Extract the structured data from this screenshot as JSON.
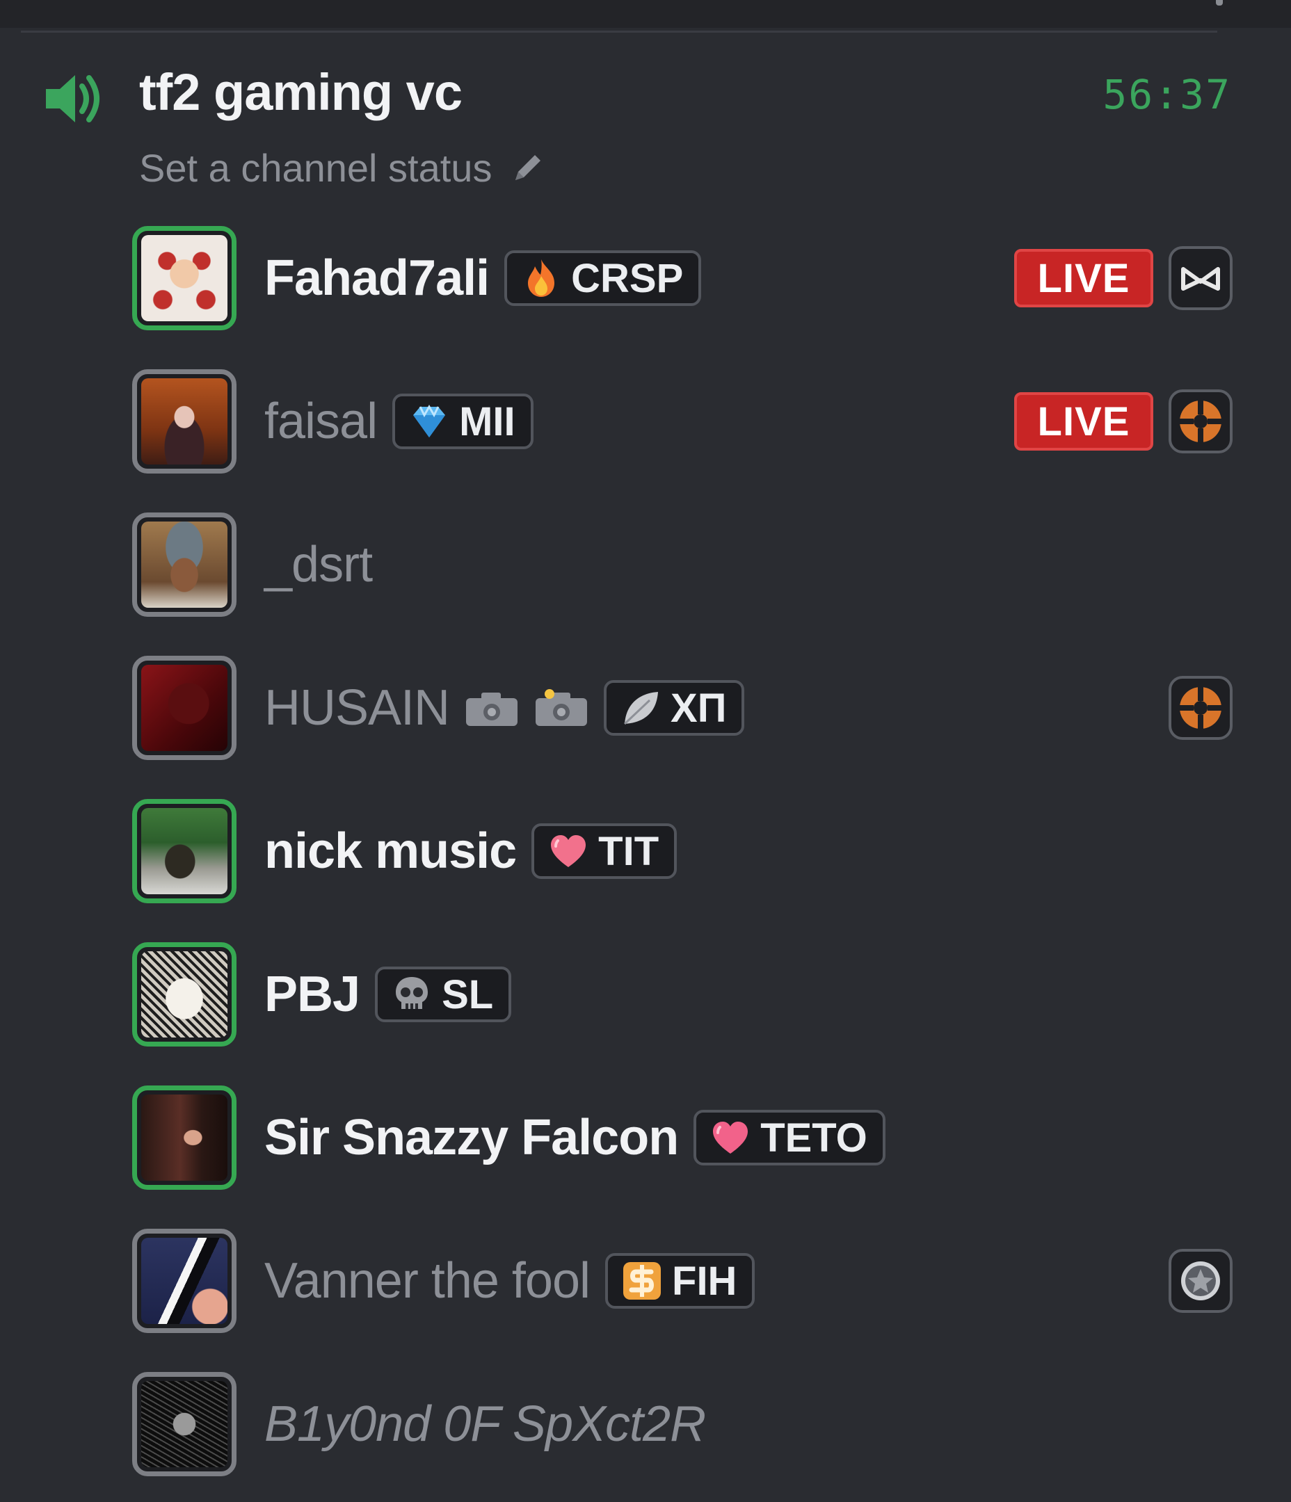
{
  "channel": {
    "name": "tf2 gaming vc",
    "timer": "56:37",
    "status_placeholder": "Set a channel status",
    "speaker_icon": "speaker-active-icon",
    "accent_color": "#3ba55d"
  },
  "members": [
    {
      "name": "Fahad7ali",
      "speaking": true,
      "tag": {
        "icon": "fire-icon",
        "label": "CRSP"
      },
      "live_label": "LIVE",
      "activity_icon": "mask-activity-icon"
    },
    {
      "name": "faisal",
      "speaking": false,
      "tag": {
        "icon": "diamond-icon",
        "label": "MII"
      },
      "live_label": "LIVE",
      "activity_icon": "tf2-logo-icon"
    },
    {
      "name": "_dsrt",
      "speaking": false
    },
    {
      "name": "HUSAIN",
      "speaking": false,
      "extra_icons": [
        "camera-icon",
        "camera-icon"
      ],
      "tag": {
        "icon": "leaf-icon",
        "label": "XП"
      },
      "activity_icon": "tf2-logo-icon"
    },
    {
      "name": "nick music",
      "speaking": true,
      "tag": {
        "icon": "heart-icon",
        "label": "TIT"
      }
    },
    {
      "name": "PBJ",
      "speaking": true,
      "tag": {
        "icon": "skull-icon",
        "label": "SL"
      }
    },
    {
      "name": "Sir Snazzy Falcon",
      "speaking": true,
      "tag": {
        "icon": "heart-icon",
        "label": "TETO"
      }
    },
    {
      "name": "Vanner the fool",
      "speaking": false,
      "tag": {
        "icon": "dollar-icon",
        "label": "FIH"
      },
      "activity_icon": "steam-activity-icon"
    },
    {
      "name": "B1y0nd 0F SpXct2R",
      "speaking": false
    }
  ],
  "colors": {
    "background": "#2a2c31",
    "speaking_ring": "#36a852",
    "live_red": "#c82525",
    "muted_text": "#8d9097"
  }
}
